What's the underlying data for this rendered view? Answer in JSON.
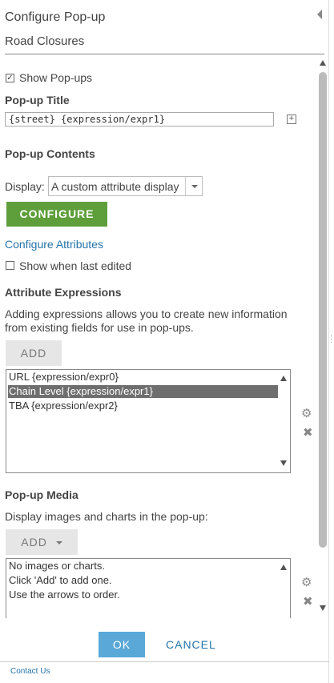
{
  "header": {
    "title": "Configure Pop-up",
    "layer": "Road Closures"
  },
  "show_popups": {
    "label": "Show Pop-ups",
    "checked": "✓"
  },
  "popup_title": {
    "heading": "Pop-up Title",
    "value": "{street}  {expression/expr1}"
  },
  "popup_contents": {
    "heading": "Pop-up Contents",
    "display_label": "Display:",
    "display_value": "A custom attribute display",
    "configure_button": "CONFIGURE",
    "configure_attributes_link": "Configure Attributes",
    "show_last_edited": "Show when last edited"
  },
  "attribute_expressions": {
    "heading": "Attribute Expressions",
    "description_line1": "Adding expressions allows you to create new information",
    "description_line2": "from existing fields for use in pop-ups.",
    "add_button": "ADD",
    "items": [
      {
        "label": "URL {expression/expr0}"
      },
      {
        "label": "Chain Level {expression/expr1}"
      },
      {
        "label": "TBA {expression/expr2}"
      }
    ]
  },
  "popup_media": {
    "heading": "Pop-up Media",
    "description": "Display images and charts in the pop-up:",
    "add_button": "ADD",
    "empty_lines": [
      "No images or charts.",
      "Click 'Add' to add one.",
      "Use the arrows to order."
    ]
  },
  "footer": {
    "ok": "OK",
    "cancel": "CANCEL",
    "contact": "Contact Us"
  },
  "icons": {
    "gear": "gear-icon",
    "remove": "remove-icon",
    "plus": "plus-icon",
    "collapse": "collapse-arrow-icon"
  },
  "colors": {
    "accent_green": "#5e9f3b",
    "ok_blue": "#5aa8d8",
    "link_blue": "#2574a9",
    "selected_row": "#6e6e6e"
  }
}
